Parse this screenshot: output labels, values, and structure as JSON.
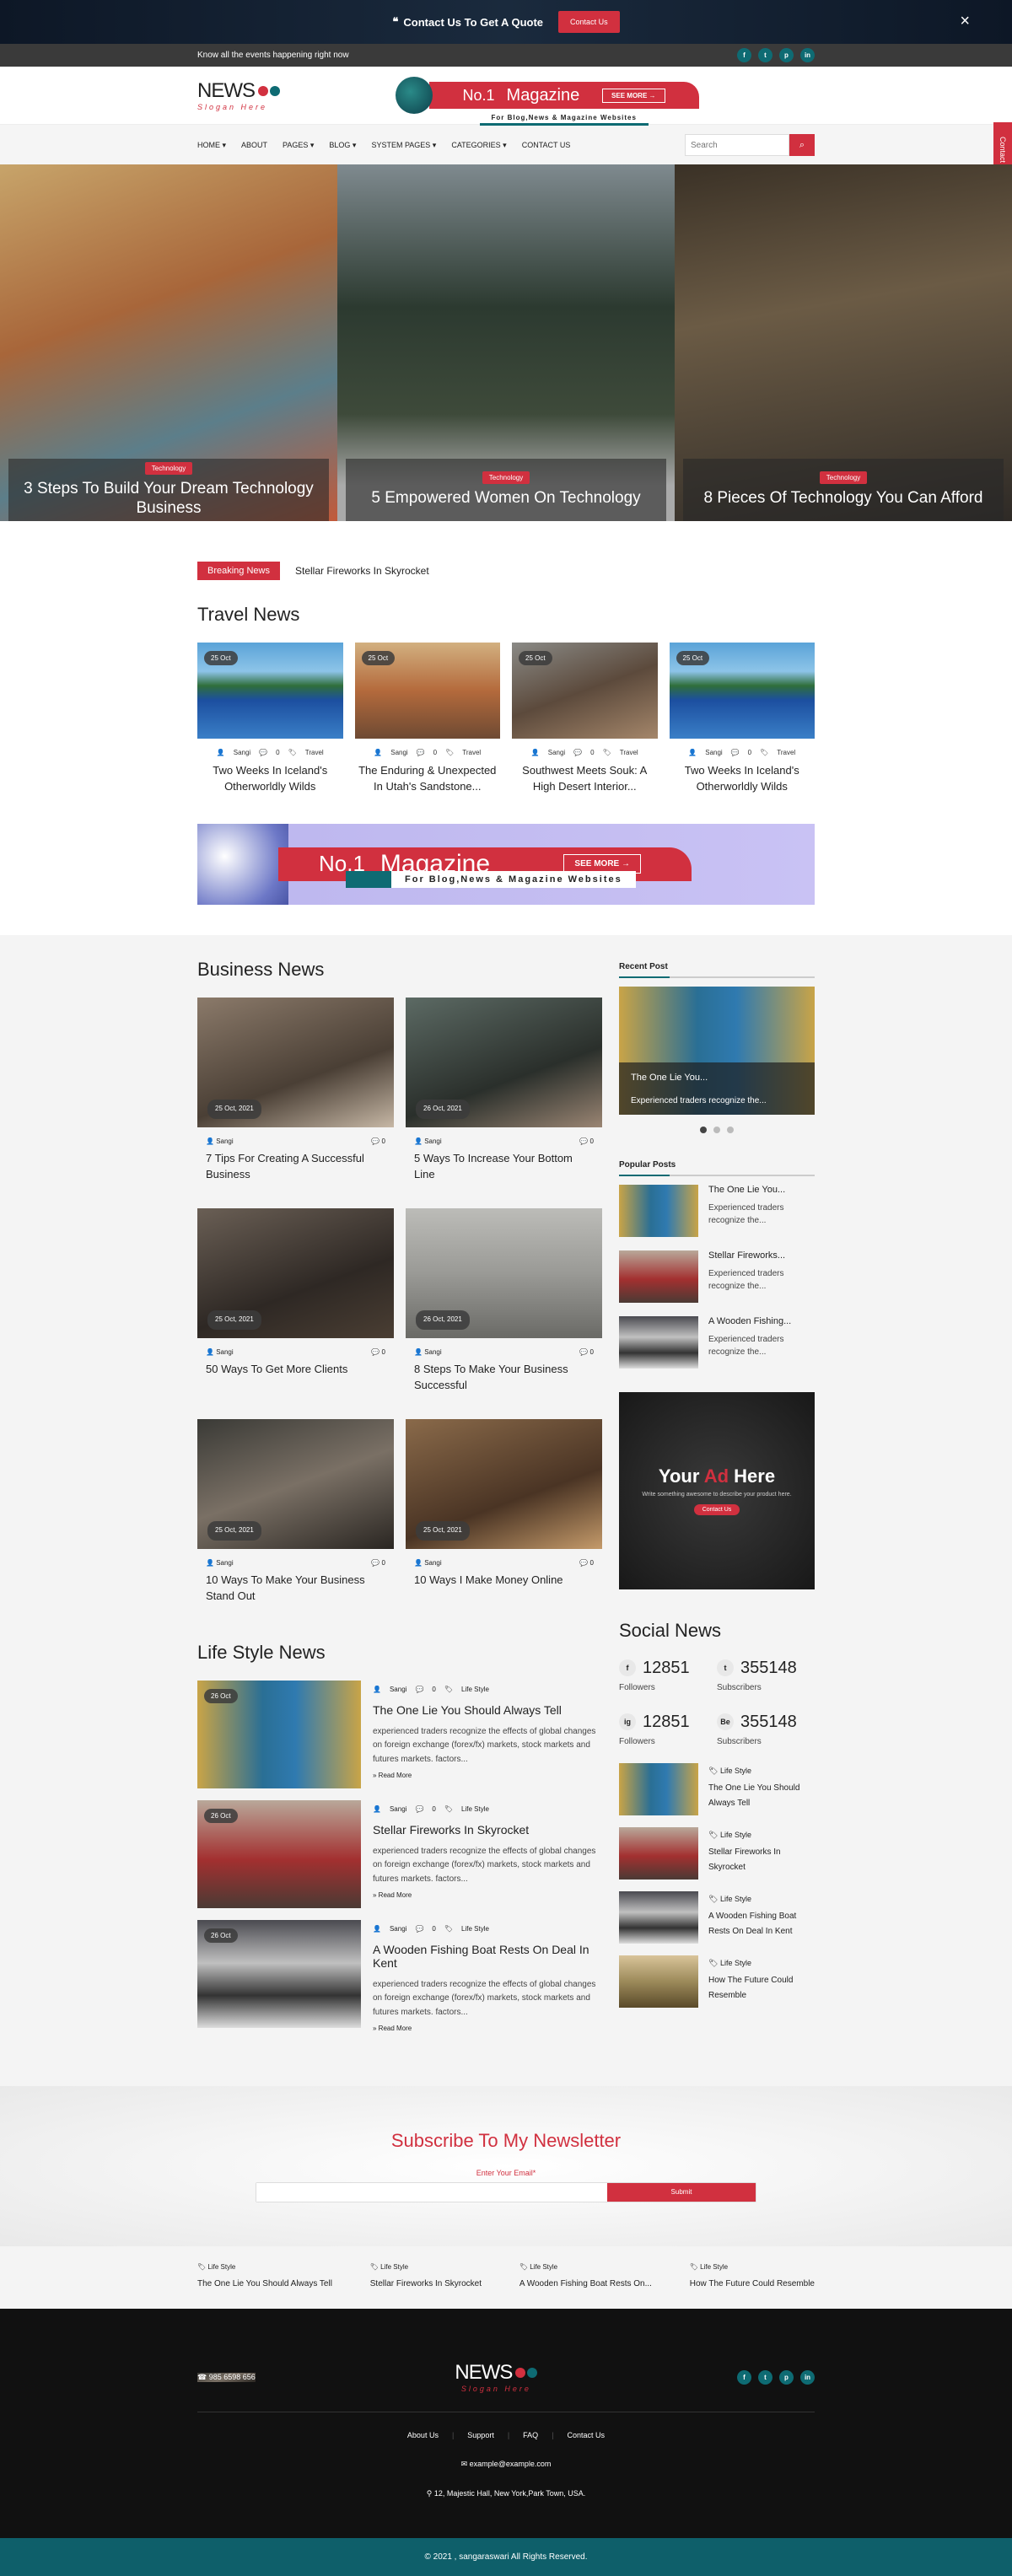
{
  "topbar": {
    "quote": "Contact Us To Get A Quote",
    "button": "Contact Us",
    "close": "×"
  },
  "announce": {
    "text": "Know all the events happening right now",
    "socials": [
      "f",
      "t",
      "p",
      "in"
    ]
  },
  "logo": {
    "title": "NEWS",
    "slogan": "Slogan Here"
  },
  "header_banner": {
    "no": "No.1",
    "mag": "Magazine",
    "see": "SEE MORE →",
    "sub": "For Blog,News & Magazine Websites"
  },
  "side_tab": "Contact Us",
  "nav": {
    "items": [
      "HOME ▾",
      "ABOUT",
      "PAGES ▾",
      "BLOG ▾",
      "SYSTEM PAGES ▾",
      "CATEGORIES ▾",
      "CONTACT US"
    ],
    "search_placeholder": "Search"
  },
  "hero": [
    {
      "tag": "Technology",
      "title": "3 Steps To Build Your Dream Technology Business"
    },
    {
      "tag": "Technology",
      "title": "5 Empowered Women On Technology"
    },
    {
      "tag": "Technology",
      "title": "8 Pieces Of Technology You Can Afford"
    }
  ],
  "breaking": {
    "label": "Breaking News",
    "text": "Stellar Fireworks In Skyrocket"
  },
  "travel": {
    "title": "Travel News",
    "items": [
      {
        "date": "25 Oct",
        "author": "Sangi",
        "comments": "0",
        "cat": "Travel",
        "title": "Two Weeks In Iceland's Otherworldly Wilds"
      },
      {
        "date": "25 Oct",
        "author": "Sangi",
        "comments": "0",
        "cat": "Travel",
        "title": "The Enduring & Unexpected In Utah's Sandstone..."
      },
      {
        "date": "25 Oct",
        "author": "Sangi",
        "comments": "0",
        "cat": "Travel",
        "title": "Southwest Meets Souk: A High Desert Interior..."
      },
      {
        "date": "25 Oct",
        "author": "Sangi",
        "comments": "0",
        "cat": "Travel",
        "title": "Two Weeks In Iceland's Otherworldly Wilds"
      }
    ]
  },
  "big_banner": {
    "no": "No.1",
    "mag": "Magazine",
    "see": "SEE MORE →",
    "sub": "For Blog,News & Magazine Websites"
  },
  "business": {
    "title": "Business News",
    "items": [
      {
        "date": "25 Oct, 2021",
        "author": "Sangi",
        "comments": "0",
        "title": "7 Tips For Creating A Successful Business"
      },
      {
        "date": "26 Oct, 2021",
        "author": "Sangi",
        "comments": "0",
        "title": "5 Ways To Increase Your Bottom Line"
      },
      {
        "date": "25 Oct, 2021",
        "author": "Sangi",
        "comments": "0",
        "title": "50 Ways To Get More Clients"
      },
      {
        "date": "26 Oct, 2021",
        "author": "Sangi",
        "comments": "0",
        "title": "8 Steps To Make Your Business Successful"
      },
      {
        "date": "25 Oct, 2021",
        "author": "Sangi",
        "comments": "0",
        "title": "10 Ways To Make Your Business Stand Out"
      },
      {
        "date": "25 Oct, 2021",
        "author": "Sangi",
        "comments": "0",
        "title": "10 Ways I Make Money Online"
      }
    ]
  },
  "recent": {
    "title": "Recent Post",
    "post_title": "The One Lie You...",
    "post_text": "Experienced traders recognize the..."
  },
  "popular": {
    "title": "Popular Posts",
    "items": [
      {
        "title": "The One Lie You...",
        "text": "Experienced traders recognize the..."
      },
      {
        "title": "Stellar Fireworks...",
        "text": "Experienced traders recognize the..."
      },
      {
        "title": "A Wooden Fishing...",
        "text": "Experienced traders recognize the..."
      }
    ]
  },
  "ad": {
    "title_a": "Your ",
    "title_b": "Ad",
    "title_c": " Here",
    "text": "Write something awesome to describe your product here.",
    "button": "Contact Us"
  },
  "social": {
    "title": "Social News",
    "stats": [
      {
        "icon": "f",
        "count": "12851",
        "label": "Followers"
      },
      {
        "icon": "t",
        "count": "355148",
        "label": "Subscribers"
      },
      {
        "icon": "ig",
        "count": "12851",
        "label": "Followers"
      },
      {
        "icon": "Be",
        "count": "355148",
        "label": "Subscribers"
      }
    ],
    "items": [
      {
        "cat": "Life Style",
        "title": "The One Lie You Should Always Tell"
      },
      {
        "cat": "Life Style",
        "title": "Stellar Fireworks In Skyrocket"
      },
      {
        "cat": "Life Style",
        "title": "A Wooden Fishing Boat Rests On Deal In Kent"
      },
      {
        "cat": "Life Style",
        "title": "How The Future Could Resemble"
      }
    ]
  },
  "lifestyle": {
    "title": "Life Style News",
    "items": [
      {
        "date": "26 Oct",
        "author": "Sangi",
        "comments": "0",
        "cat": "Life Style",
        "title": "The One Lie You Should Always Tell",
        "text": "experienced traders recognize the effects of global changes on foreign exchange (forex/fx) markets, stock markets and futures markets. factors...",
        "more": "Read More"
      },
      {
        "date": "26 Oct",
        "author": "Sangi",
        "comments": "0",
        "cat": "Life Style",
        "title": "Stellar Fireworks In Skyrocket",
        "text": "experienced traders recognize the effects of global changes on foreign exchange (forex/fx) markets, stock markets and futures markets. factors...",
        "more": "Read More"
      },
      {
        "date": "26 Oct",
        "author": "Sangi",
        "comments": "0",
        "cat": "Life Style",
        "title": "A Wooden Fishing Boat Rests On Deal In Kent",
        "text": "experienced traders recognize the effects of global changes on foreign exchange (forex/fx) markets, stock markets and futures markets. factors...",
        "more": "Read More"
      }
    ]
  },
  "newsletter": {
    "title_a": "Subscribe To My ",
    "title_b": "Newsletter",
    "label": "Enter Your Email*",
    "button": "Submit"
  },
  "strip": [
    {
      "cat": "Life Style",
      "title": "The One Lie You Should Always Tell"
    },
    {
      "cat": "Life Style",
      "title": "Stellar Fireworks In Skyrocket"
    },
    {
      "cat": "Life Style",
      "title": "A Wooden Fishing Boat Rests On..."
    },
    {
      "cat": "Life Style",
      "title": "How The Future Could Resemble"
    }
  ],
  "footer": {
    "phone": "985 6598 656",
    "links": [
      "About Us",
      "Support",
      "FAQ",
      "Contact Us"
    ],
    "email": "example@example.com",
    "address": "12, Majestic Hall, New York,Park Town, USA.",
    "copyright": "© 2021 , sangaraswari All Rights Reserved."
  },
  "colors": {
    "accent": "#d1303f",
    "teal": "#0e6b73"
  }
}
